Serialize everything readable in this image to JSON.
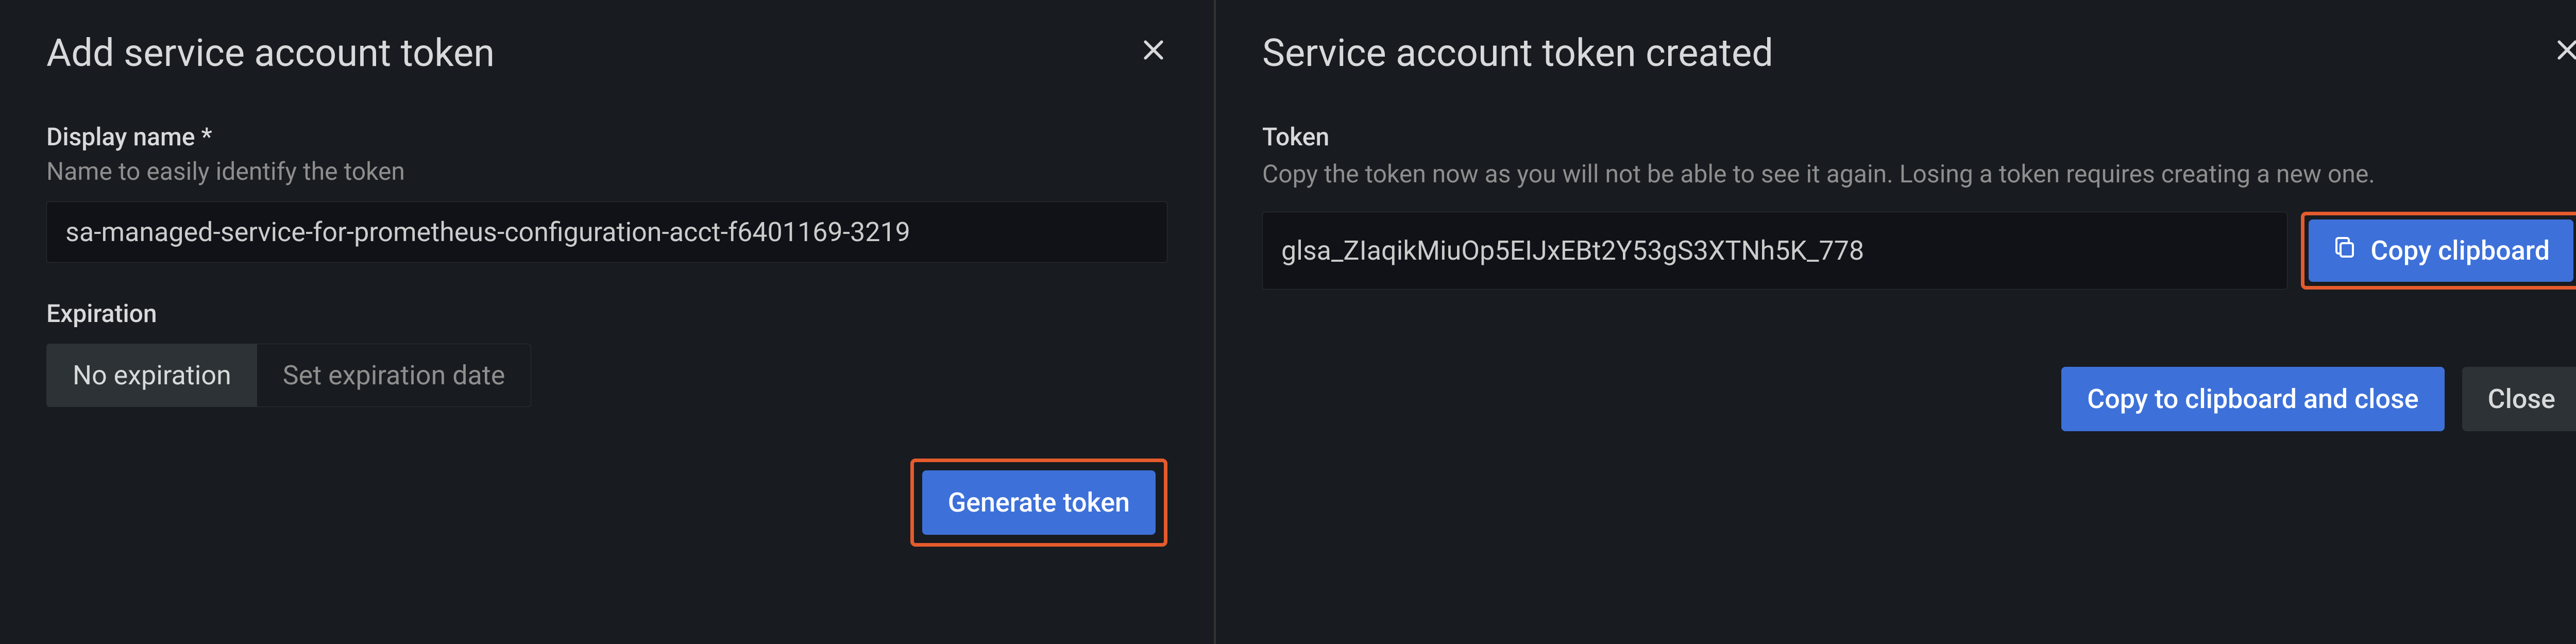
{
  "left": {
    "title": "Add service account token",
    "displayName": {
      "label": "Display name *",
      "help": "Name to easily identify the token",
      "value": "sa-managed-service-for-prometheus-configuration-acct-f6401169-3219"
    },
    "expiration": {
      "label": "Expiration",
      "options": {
        "noExpiration": "No expiration",
        "setDate": "Set expiration date"
      }
    },
    "generateButton": "Generate token"
  },
  "right": {
    "title": "Service account token created",
    "token": {
      "label": "Token",
      "help": "Copy the token now as you will not be able to see it again. Losing a token requires creating a new one.",
      "value": "glsa_ZIaqikMiuOp5EIJxEBt2Y53gS3XTNh5K_778"
    },
    "copyButton": "Copy clipboard",
    "copyCloseButton": "Copy to clipboard and close",
    "closeButton": "Close"
  }
}
